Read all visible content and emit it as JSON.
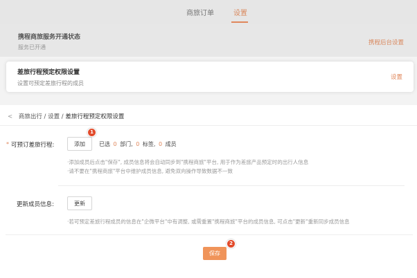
{
  "tabs": [
    {
      "label": "商旅订单"
    },
    {
      "label": "设置"
    }
  ],
  "service_status": {
    "title": "携程商旅服务开通状态",
    "subtitle": "服务已开通",
    "link": "携程后台设置"
  },
  "permission_card": {
    "title": "差旅行程预定权限设置",
    "subtitle": "设置可预定差旅行程的成员",
    "link": "设置"
  },
  "breadcrumb": {
    "back": "<",
    "path": "商旅出行 / 设置 /",
    "current": "差旅行程预定权限设置"
  },
  "travel_field": {
    "required_mark": "*",
    "label": "可预订差旅行程:",
    "add_button": "添加",
    "summary": {
      "prefix": "已选",
      "dept_count": "0",
      "dept_unit": "部门,",
      "tag_count": "0",
      "tag_unit": "标签,",
      "member_count": "0",
      "member_unit": "成员"
    },
    "hint_1": "·添加成员后点击\"保存\", 成员信息将会自动同步到\"携程商旅\"平台, 用于作为差旅产品预定时的出行人信息",
    "hint_2": "·请不要在\"携程商旅\"平台中维护成员信息, 避免双向操作导致数据不一致"
  },
  "update_field": {
    "label": "更新成员信息:",
    "button": "更新",
    "hint": "·若可预定差旅行程成员的信息在\"企微平台\"中有调整, 或需重置\"携程商旅\"平台的成员信息, 可点击\"更新\"重新同步成员信息"
  },
  "save_button": "保存",
  "badges": [
    "1",
    "2"
  ],
  "colors": {
    "accent": "#e0875b",
    "save_button": "#f0945a",
    "badge": "#e24b2b"
  }
}
